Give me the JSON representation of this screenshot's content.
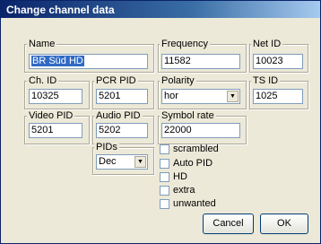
{
  "window": {
    "title": "Change channel data"
  },
  "fields": {
    "name": {
      "label": "Name",
      "value": "BR Süd HD"
    },
    "frequency": {
      "label": "Frequency",
      "value": "11582"
    },
    "net_id": {
      "label": "Net ID",
      "value": "10023"
    },
    "ch_id": {
      "label": "Ch. ID",
      "value": "10325"
    },
    "pcr_pid": {
      "label": "PCR PID",
      "value": "5201"
    },
    "polarity": {
      "label": "Polarity",
      "value": "hor"
    },
    "ts_id": {
      "label": "TS ID",
      "value": "1025"
    },
    "video_pid": {
      "label": "Video PID",
      "value": "5201"
    },
    "audio_pid": {
      "label": "Audio PID",
      "value": "5202"
    },
    "symbol_rate": {
      "label": "Symbol rate",
      "value": "22000"
    },
    "pids": {
      "label": "PIDs",
      "value": "Dec"
    }
  },
  "checkboxes": {
    "scrambled": {
      "label": "scrambled",
      "checked": false
    },
    "auto_pid": {
      "label": "Auto PID",
      "checked": false
    },
    "hd": {
      "label": "HD",
      "checked": false
    },
    "extra": {
      "label": "extra",
      "checked": false
    },
    "unwanted": {
      "label": "unwanted",
      "checked": false
    }
  },
  "buttons": {
    "cancel": "Cancel",
    "ok": "OK"
  }
}
